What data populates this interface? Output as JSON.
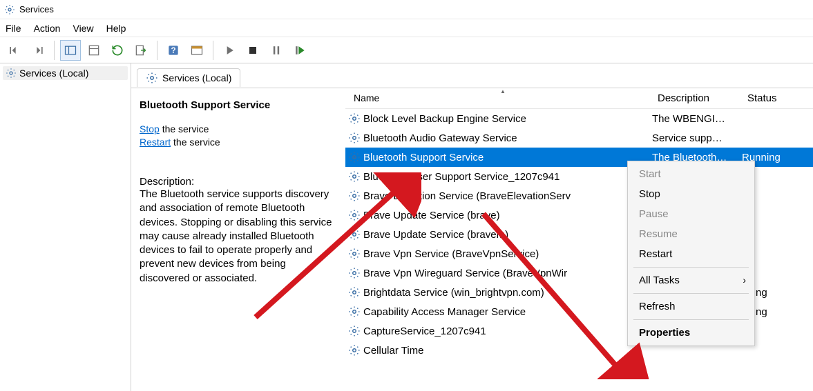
{
  "window": {
    "title": "Services"
  },
  "menu": {
    "file": "File",
    "action": "Action",
    "view": "View",
    "help": "Help"
  },
  "tree": {
    "root": "Services (Local)"
  },
  "tab": {
    "label": "Services (Local)"
  },
  "detail": {
    "title": "Bluetooth Support Service",
    "stop_link": "Stop",
    "stop_suffix": " the service",
    "restart_link": "Restart",
    "restart_suffix": " the service",
    "desc_label": "Description:",
    "desc_text": "The Bluetooth service supports discovery and association of remote Bluetooth devices.  Stopping or disabling this service may cause already installed Bluetooth devices to fail to operate properly and prevent new devices from being discovered or associated."
  },
  "columns": {
    "name": "Name",
    "description": "Description",
    "status": "Status"
  },
  "services": [
    {
      "name": "Block Level Backup Engine Service",
      "desc": "The WBENGI…",
      "status": ""
    },
    {
      "name": "Bluetooth Audio Gateway Service",
      "desc": "Service supp…",
      "status": ""
    },
    {
      "name": "Bluetooth Support Service",
      "desc": "The Bluetooth…",
      "status": "Running",
      "selected": true
    },
    {
      "name": "Bluetooth User Support Service_1207c941",
      "desc": "",
      "status": ""
    },
    {
      "name": "Brave Elevation Service (BraveElevationServ",
      "desc": "",
      "status": ""
    },
    {
      "name": "Brave Update Service (brave)",
      "desc": "",
      "status": ""
    },
    {
      "name": "Brave Update Service (bravem)",
      "desc": "",
      "status": ""
    },
    {
      "name": "Brave Vpn Service (BraveVpnService)",
      "desc": "",
      "status": ""
    },
    {
      "name": "Brave Vpn Wireguard Service (BraveVpnWir",
      "desc": "",
      "status": ""
    },
    {
      "name": "Brightdata Service (win_brightvpn.com)",
      "desc": "",
      "status": "nning"
    },
    {
      "name": "Capability Access Manager Service",
      "desc": "",
      "status": "nning"
    },
    {
      "name": "CaptureService_1207c941",
      "desc": "",
      "status": ""
    },
    {
      "name": "Cellular Time",
      "desc": "",
      "status": ""
    }
  ],
  "context_menu": {
    "start": "Start",
    "stop": "Stop",
    "pause": "Pause",
    "resume": "Resume",
    "restart": "Restart",
    "all_tasks": "All Tasks",
    "refresh": "Refresh",
    "properties": "Properties"
  }
}
